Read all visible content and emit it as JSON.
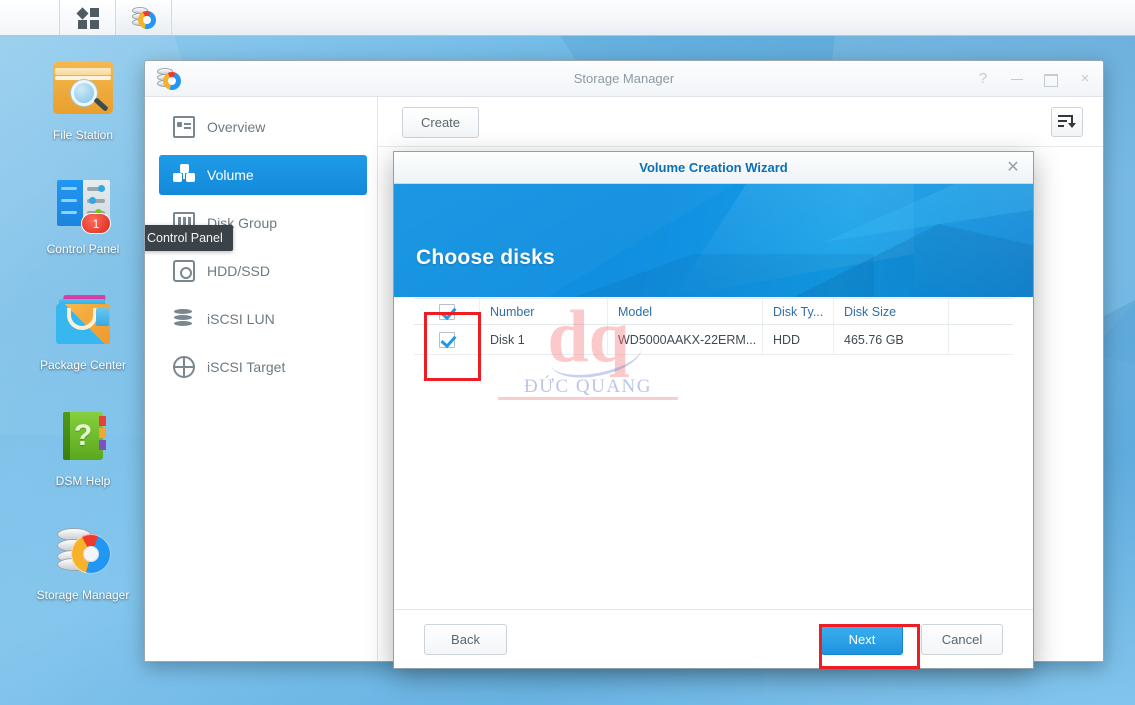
{
  "taskbar": {
    "buttons": [
      {
        "name": "app-menu",
        "icon": "tiles-icon",
        "label": ""
      },
      {
        "name": "storage-manager-task",
        "icon": "storage-manager-icon",
        "label": ""
      }
    ]
  },
  "desktop": {
    "icons": [
      {
        "label": "File Station",
        "icon": "file-station-icon",
        "badge": ""
      },
      {
        "label": "Control Panel",
        "icon": "control-panel-icon",
        "badge": "1"
      },
      {
        "label": "Package Center",
        "icon": "package-center-icon",
        "badge": ""
      },
      {
        "label": "DSM Help",
        "icon": "dsm-help-icon",
        "badge": ""
      },
      {
        "label": "Storage Manager",
        "icon": "storage-manager-icon",
        "badge": ""
      }
    ],
    "tooltip": "Control Panel"
  },
  "window": {
    "title": "Storage Manager",
    "controls": {
      "help": "?",
      "minimize": "–",
      "maximize": "□",
      "close": "×"
    },
    "toolbar": {
      "create_label": "Create",
      "sort_icon": "sort-descending-icon"
    },
    "sidebar": {
      "items": [
        {
          "label": "Overview",
          "icon": "overview-icon",
          "active": false
        },
        {
          "label": "Volume",
          "icon": "volume-icon",
          "active": true
        },
        {
          "label": "Disk Group",
          "icon": "disk-group-icon",
          "active": false
        },
        {
          "label": "HDD/SSD",
          "icon": "hdd-ssd-icon",
          "active": false
        },
        {
          "label": "iSCSI LUN",
          "icon": "iscsi-lun-icon",
          "active": false
        },
        {
          "label": "iSCSI Target",
          "icon": "iscsi-target-icon",
          "active": false
        }
      ]
    }
  },
  "wizard": {
    "title": "Volume Creation Wizard",
    "close_icon": "close-icon",
    "heading": "Choose disks",
    "table": {
      "headers": [
        "",
        "Number",
        "Model",
        "Disk Ty...",
        "Disk Size"
      ],
      "header_checkbox_checked": true,
      "rows": [
        {
          "checked": true,
          "number": "Disk 1",
          "model": "WD5000AAKX-22ERM...",
          "disk_type": "HDD",
          "disk_size": "465.76 GB"
        }
      ]
    },
    "footer": {
      "back_label": "Back",
      "next_label": "Next",
      "cancel_label": "Cancel"
    }
  },
  "watermark": {
    "logo": "dq",
    "text": "ĐỨC QUANG"
  },
  "colors": {
    "accent": "#1e94e0",
    "wizard_title": "#0b6fb5",
    "highlight": "#ee1d23",
    "sidebar_active": "#1489da",
    "desktop": "#7cc2ec"
  }
}
